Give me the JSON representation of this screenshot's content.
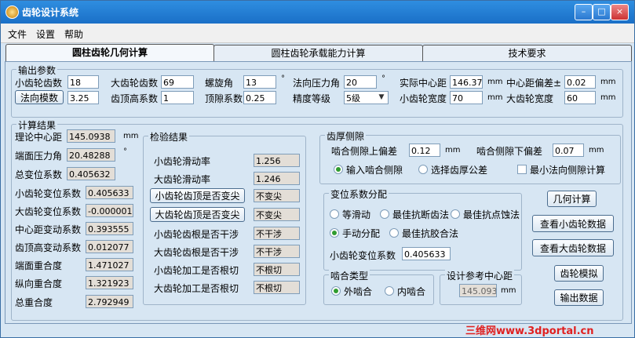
{
  "window": {
    "title": "齿轮设计系统",
    "min_label": "–",
    "max_label": "□",
    "close_label": "×"
  },
  "menu": [
    "文件",
    "设置",
    "帮助"
  ],
  "tabs": [
    "圆柱齿轮几何计算",
    "圆柱齿轮承载能力计算",
    "技术要求"
  ],
  "input": {
    "legend": "输出参数",
    "z1_label": "小齿轮齿数",
    "z1": "18",
    "z2_label": "大齿轮齿数",
    "z2": "69",
    "helix_label": "螺旋角",
    "helix": "13",
    "helix_unit": "°",
    "pressure_label": "法向压力角",
    "pressure": "20",
    "pressure_unit": "°",
    "center_label": "实际中心距",
    "center": "146.37",
    "center_unit": "mm",
    "center_dev_label": "中心距偏差±",
    "center_dev": "0.02",
    "center_dev_unit": "mm",
    "module_button": "法向模数",
    "module": "3.25",
    "addendum_label": "齿顶高系数",
    "addendum": "1",
    "clearance_label": "顶隙系数",
    "clearance": "0.25",
    "grade_label": "精度等级",
    "grade": "5级",
    "b1_label": "小齿轮宽度",
    "b1": "70",
    "b1_unit": "mm",
    "b2_label": "大齿轮宽度",
    "b2": "60",
    "b2_unit": "mm"
  },
  "results": {
    "legend": "计算结果",
    "theory_center_label": "理论中心距",
    "theory_center": "145.0938",
    "theory_center_unit": "mm",
    "transverse_pa_label": "端面压力角",
    "transverse_pa": "20.48288",
    "transverse_pa_unit": "°",
    "total_shift_label": "总变位系数",
    "total_shift": "0.405632",
    "x1_label": "小齿轮变位系数",
    "x1": "0.405633",
    "x2_label": "大齿轮变位系数",
    "x2": "-0.000001",
    "center_shift_label": "中心距变动系数",
    "center_shift": "0.393555",
    "tip_reduction_label": "齿顶高变动系数",
    "tip_reduction": "0.012077",
    "transverse_ratio_label": "端面重合度",
    "transverse_ratio": "1.471027",
    "overlap_ratio_label": "纵向重合度",
    "overlap_ratio": "1.321923",
    "total_ratio_label": "总重合度",
    "total_ratio": "2.792949"
  },
  "check": {
    "legend": "检验结果",
    "slide1_label": "小齿轮滑动率",
    "slide1": "1.256",
    "slide2_label": "大齿轮滑动率",
    "slide2": "1.246",
    "tip1_button": "小齿轮齿顶是否变尖",
    "tip1": "不变尖",
    "tip2_button": "大齿轮齿顶是否变尖",
    "tip2": "不变尖",
    "root1_label": "小齿轮齿根是否干涉",
    "root1": "不干涉",
    "root2_label": "大齿轮齿根是否干涉",
    "root2": "不干涉",
    "undercut1_label": "小齿轮加工是否根切",
    "undercut1": "不根切",
    "undercut2_label": "大齿轮加工是否根切",
    "undercut2": "不根切"
  },
  "backlash": {
    "legend": "齿厚侧隙",
    "upper_label": "啮合侧隙上偏差",
    "upper": "0.12",
    "upper_unit": "mm",
    "lower_label": "啮合侧隙下偏差",
    "lower": "0.07",
    "lower_unit": "mm",
    "opt_input": "输入啮合侧隙",
    "opt_select": "选择齿厚公差",
    "opt_min": "最小法向侧隙计算"
  },
  "shift": {
    "legend": "变位系数分配",
    "opt_equal": "等滑动",
    "opt_break": "最佳抗断齿法",
    "opt_pitting": "最佳抗点蚀法",
    "opt_manual": "手动分配",
    "opt_glue": "最佳抗胶合法",
    "x1_label": "小齿轮变位系数",
    "x1": "0.405633"
  },
  "mesh": {
    "legend": "啮合类型",
    "external": "外啮合",
    "internal": "内啮合"
  },
  "design_center": {
    "legend": "设计参考中心距",
    "value": "145.093",
    "unit": "mm"
  },
  "actions": {
    "geometry": "几何计算",
    "small_data": "查看小齿轮数据",
    "large_data": "查看大齿轮数据",
    "simulate": "齿轮模拟",
    "export": "输出数据"
  },
  "watermark": "三维网www.3dportal.cn"
}
